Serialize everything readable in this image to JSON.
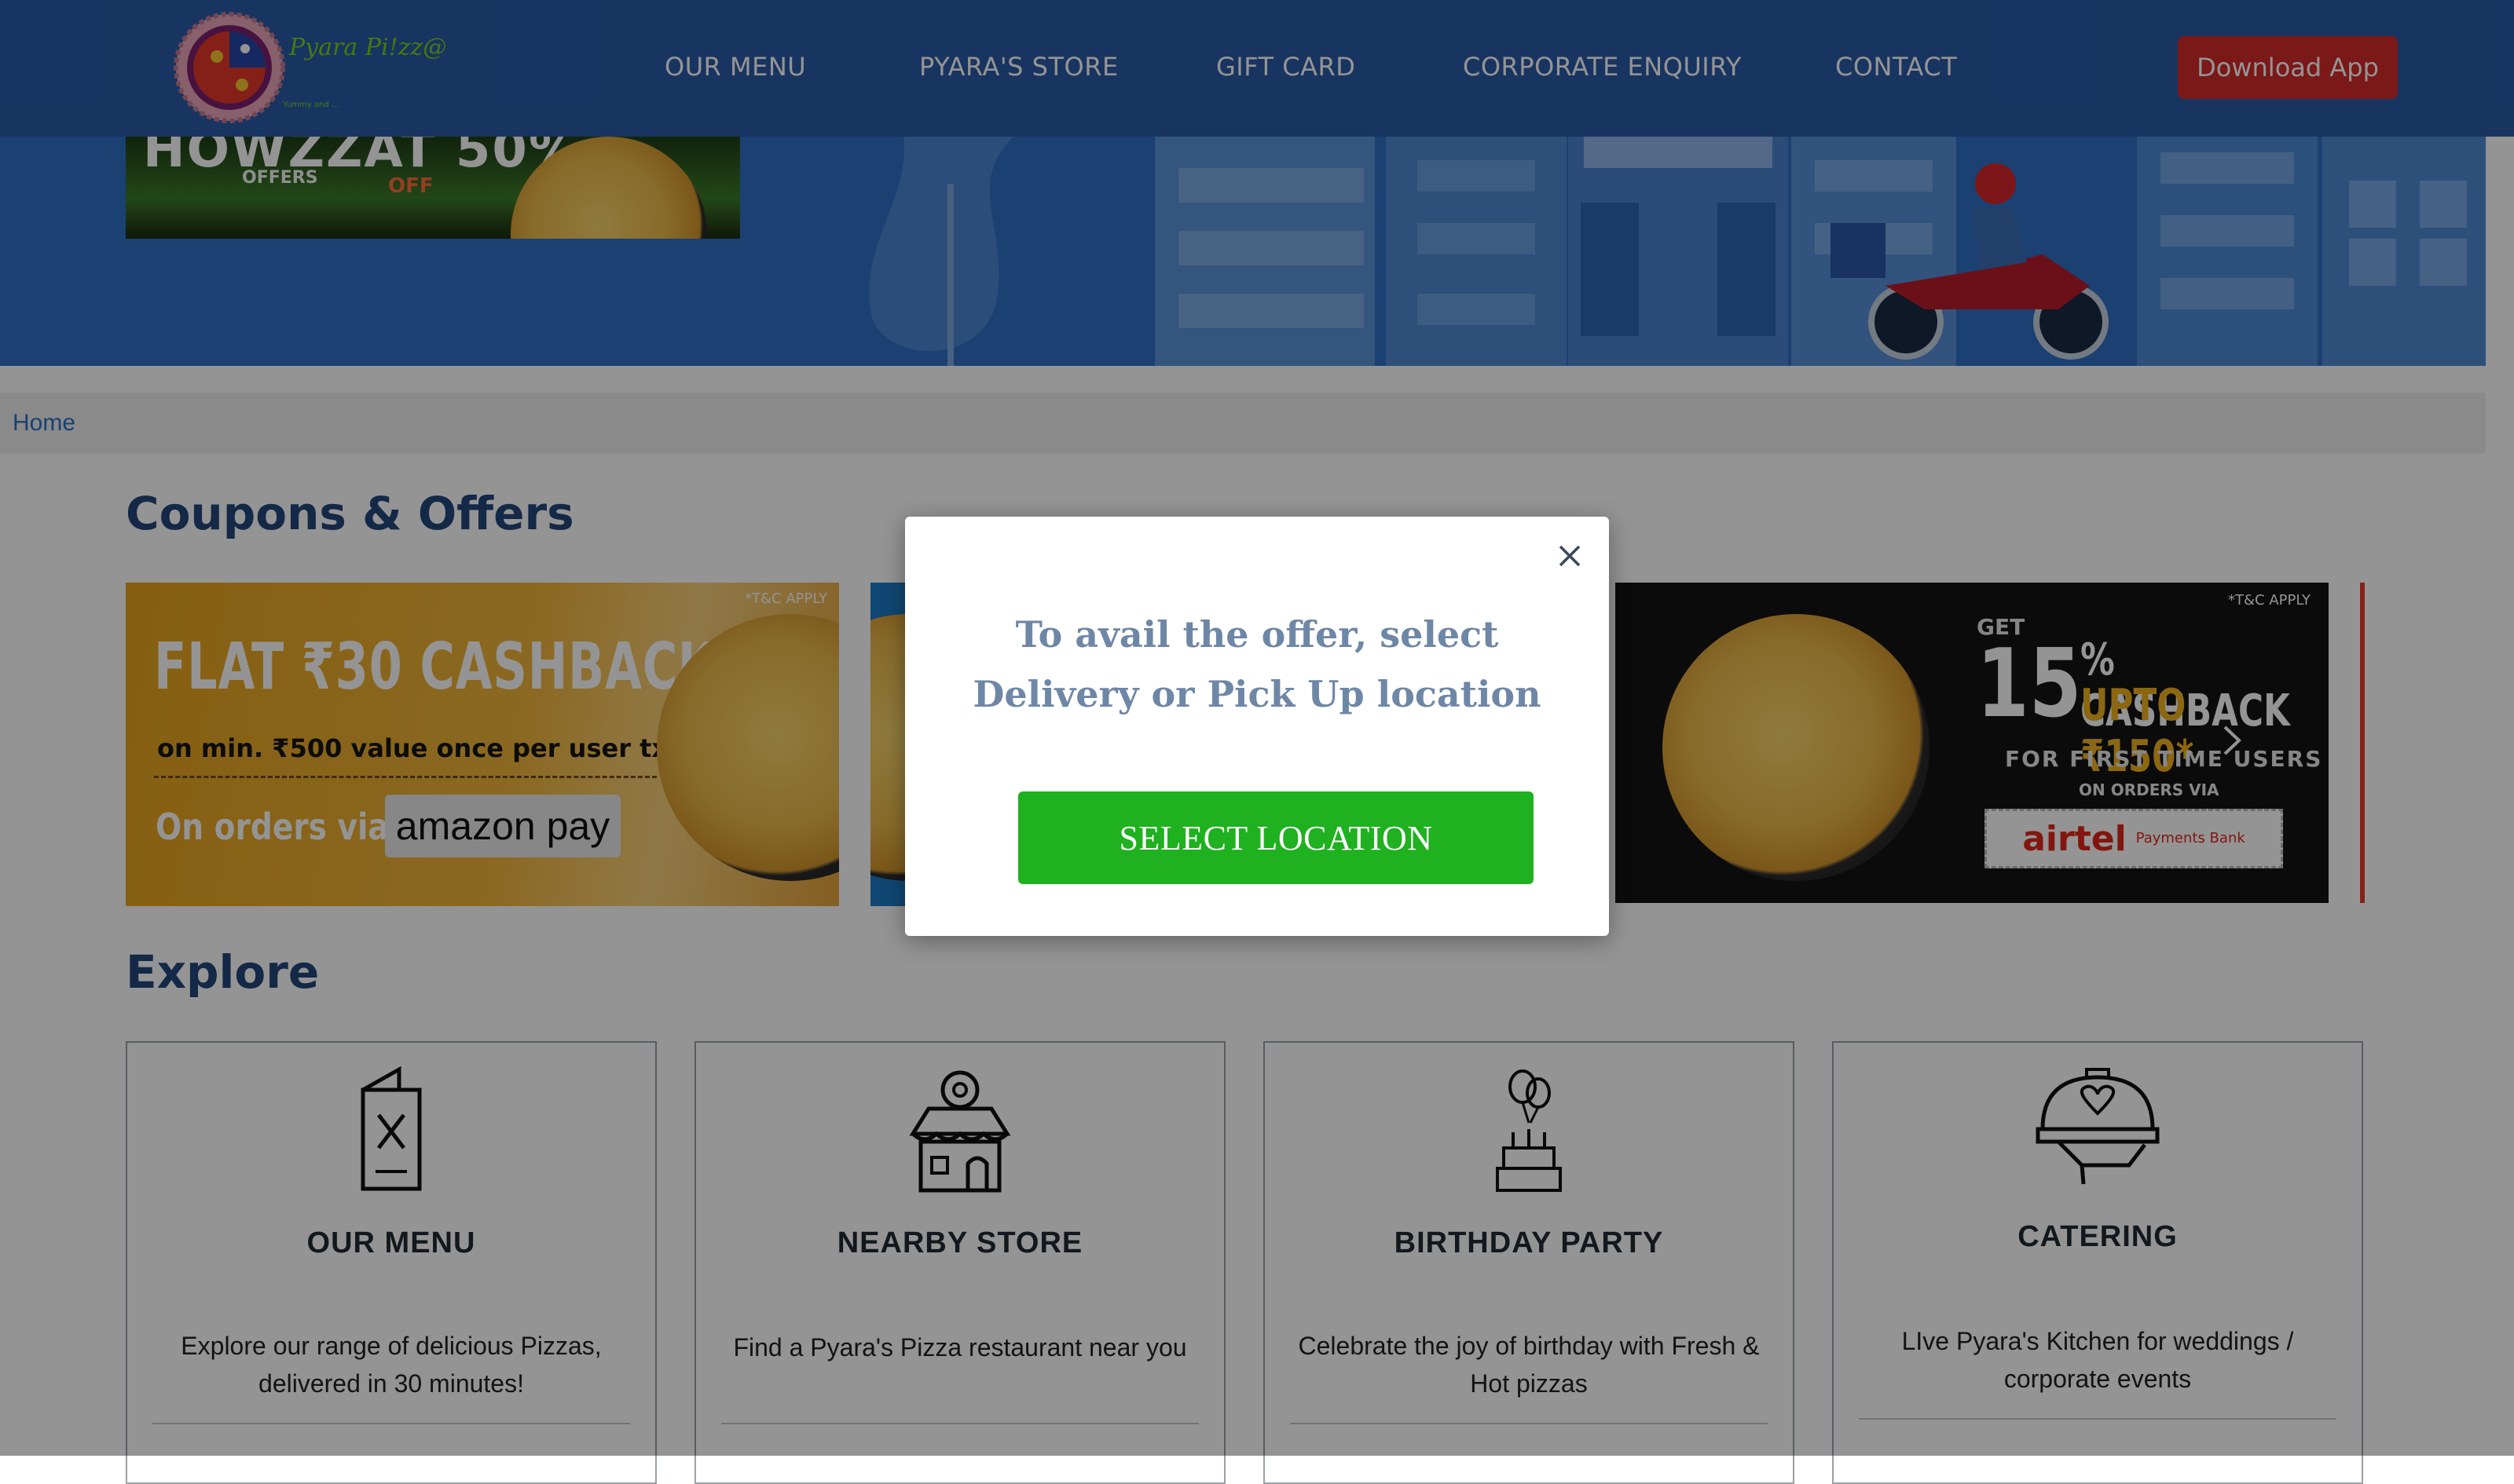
{
  "brand": {
    "name": "Pyara Pi!zz@",
    "tagline": "Yummy and ..."
  },
  "nav": {
    "items": [
      "OUR MENU",
      "PYARA'S STORE",
      "GIFT CARD",
      "CORPORATE ENQUIRY",
      "CONTACT"
    ],
    "download_label": "Download App"
  },
  "banner": {
    "promo_text": "HOWZZAT 50%",
    "promo_offers": "OFFERS",
    "promo_off": "OFF"
  },
  "breadcrumb": {
    "home": "Home"
  },
  "coupons": {
    "title": "Coupons & Offers",
    "card1": {
      "tc": "*T&C APPLY",
      "headline": "FLAT ₹30 CASHBACK",
      "condition": "on min. ₹500 value once per user txn.",
      "via": "On orders via",
      "partner": "amazon pay"
    },
    "card3": {
      "tc": "*T&C APPLY",
      "get": "GET",
      "big": "15",
      "cashback": "% CASHBACK",
      "upto": "UPTO ₹150*",
      "first": "FOR FIRST TIME USERS",
      "on_orders": "ON ORDERS VIA",
      "partner": "airtel",
      "partner_sub": "Payments Bank"
    }
  },
  "explore": {
    "title": "Explore",
    "cards": [
      {
        "title": "OUR MENU",
        "desc": "Explore our range of delicious Pizzas, delivered in 30 minutes!"
      },
      {
        "title": "NEARBY STORE",
        "desc": "Find a Pyara's Pizza restaurant near you"
      },
      {
        "title": "BIRTHDAY PARTY",
        "desc": "Celebrate the joy of birthday with Fresh & Hot pizzas"
      },
      {
        "title": "CATERING",
        "desc": "LIve Pyara's Kitchen for weddings / corporate events"
      }
    ]
  },
  "modal": {
    "message": "To avail the offer, select Delivery or Pick Up location",
    "button": "SELECT LOCATION"
  },
  "colors": {
    "header": "#2a5aa8",
    "accent_red": "#d42a2a",
    "button_green": "#1fb11f",
    "title_blue": "#23457a"
  }
}
